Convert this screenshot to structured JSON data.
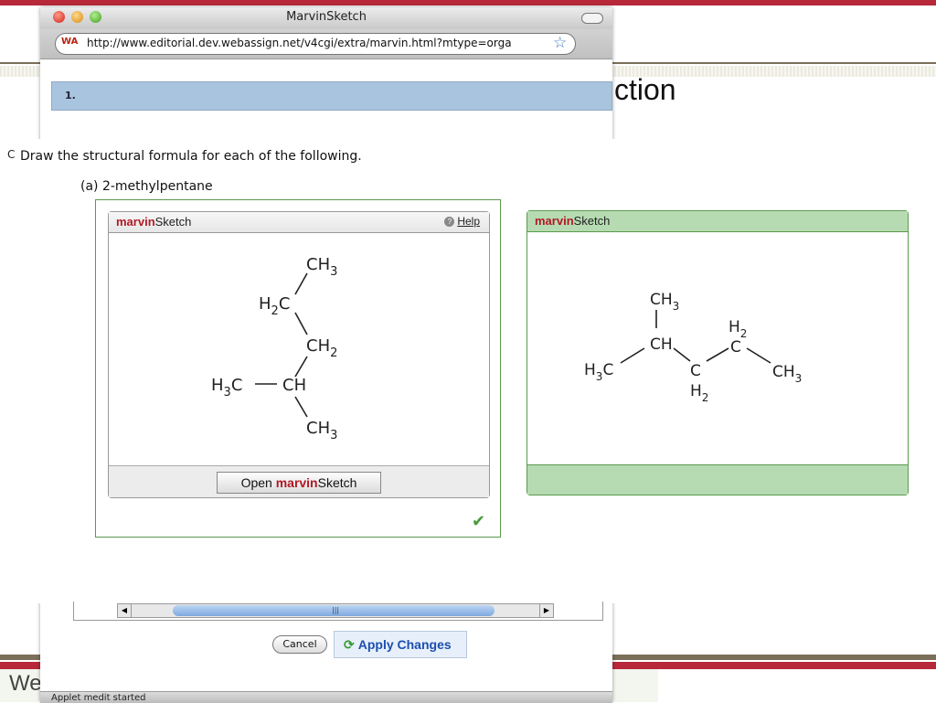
{
  "slide": {
    "title_fragment": "ction",
    "footer_fragment": "We"
  },
  "window": {
    "title": "MarvinSketch",
    "url": "http://www.editorial.dev.webassign.net/v4cgi/extra/marvin.html?mtype=orga",
    "site_icon_text": "WA",
    "status_text": "Applet medit started"
  },
  "question": {
    "number": "1.",
    "letter_fragment": "C",
    "prompt": "Draw the structural formula for each of the following.",
    "part": "(a) 2-methylpentane"
  },
  "student_sketch": {
    "brand_bold": "marvin",
    "brand_rest": "Sketch",
    "help_label": "Help",
    "open_button_prefix": "Open ",
    "open_button_bold": "marvin",
    "open_button_rest": "Sketch",
    "atoms": [
      "CH3",
      "H2C",
      "CH2",
      "H3C",
      "CH",
      "CH3"
    ]
  },
  "key_sketch": {
    "brand_bold": "marvin",
    "brand_rest": "Sketch",
    "atoms": [
      "CH3",
      "H2",
      "CH",
      "C",
      "H3C",
      "C",
      "CH3",
      "H2"
    ]
  },
  "buttons": {
    "cancel": "Cancel",
    "apply": "Apply Changes"
  },
  "colors": {
    "marvin_red": "#b01925",
    "correct_green": "#4a9a3a",
    "question_header": "#a9c4df",
    "key_panel": "#b6dbb2"
  }
}
